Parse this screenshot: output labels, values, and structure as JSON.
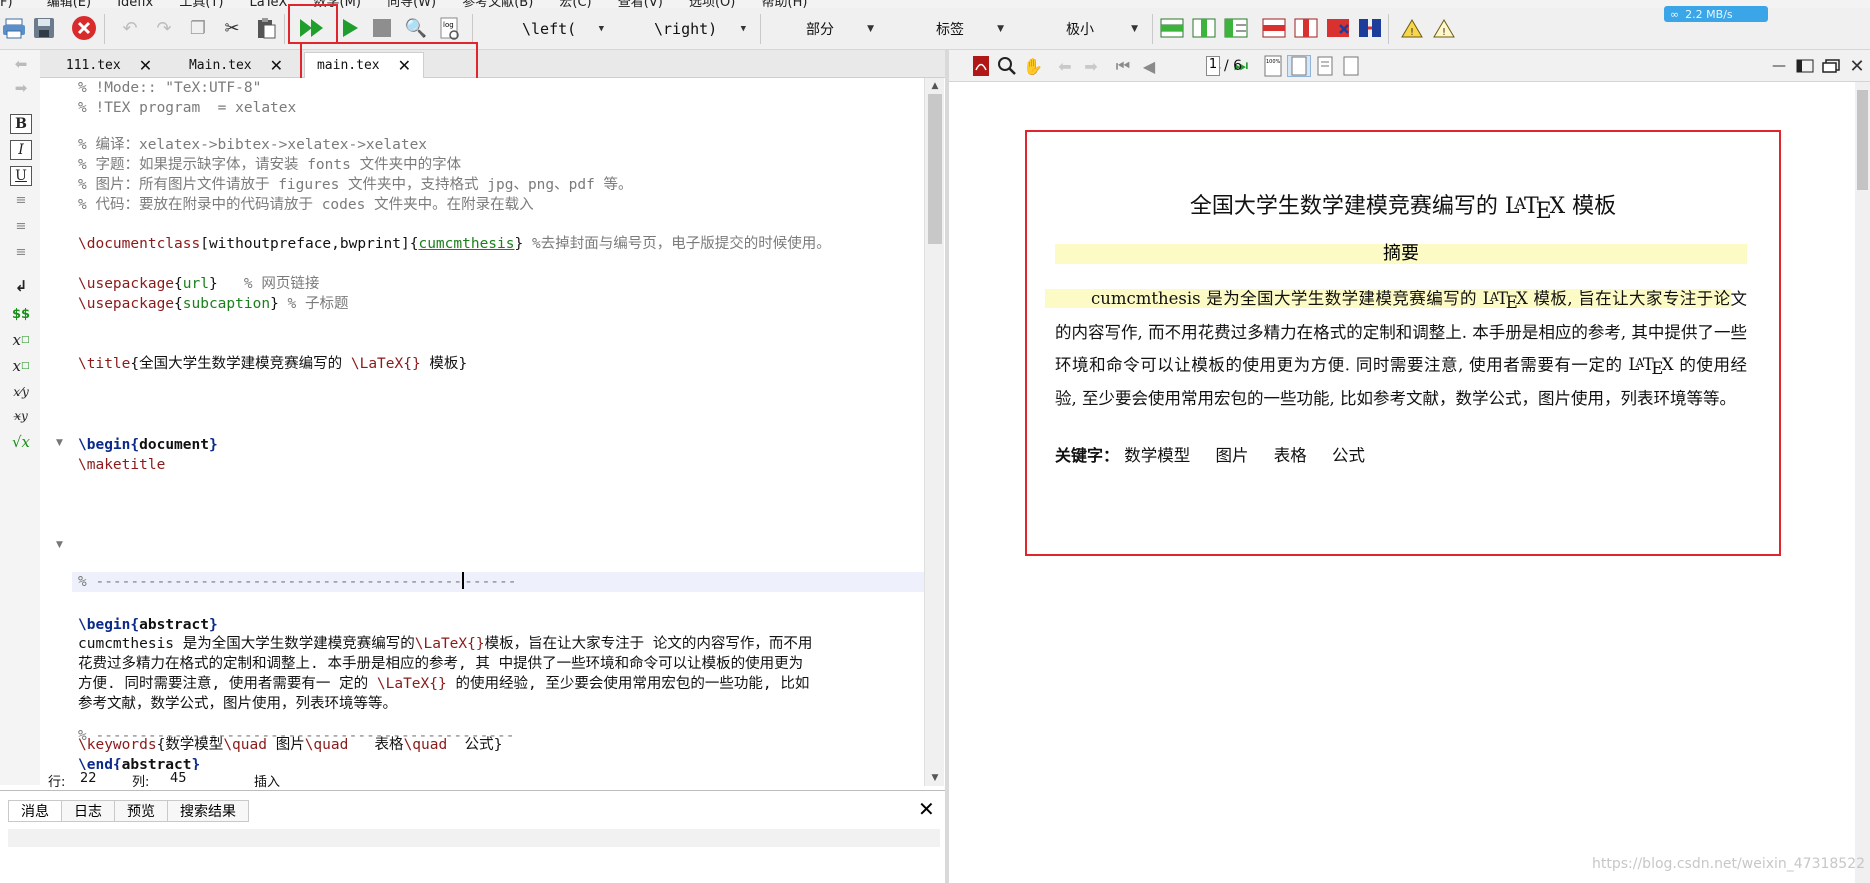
{
  "menubar": {
    "items": [
      "F)",
      "编辑(E)",
      "Idefix",
      "工具(T)",
      "LaTeX",
      "数学(M)",
      "向导(W)",
      "参考文献(B)",
      "宏(C)",
      "查看(V)",
      "选项(O)",
      "帮助(H)"
    ]
  },
  "net_speed": "2.2 MB/s",
  "toolbar": {
    "combo_left": "\\left(",
    "combo_right": "\\right)",
    "combo_section": "部分",
    "combo_label": "标签",
    "combo_size": "极小"
  },
  "tabs": [
    {
      "label": "111.tex"
    },
    {
      "label": "Main.tex"
    },
    {
      "label": "main.tex"
    }
  ],
  "tab_close_glyph": "✕",
  "editor": {
    "l01": "% !Mode:: \"TeX:UTF-8\"",
    "l02": "% !TEX program  = xelatex",
    "l03": "% 编译：xelatex->bibtex->xelatex->xelatex",
    "l04": "% 字题：如果提示缺字体，请安装 fonts 文件夹中的字体",
    "l05": "% 图片：所有图片文件请放于 figures 文件夹中，支持格式 jpg、png、pdf 等。",
    "l06": "% 代码：要放在附录中的代码请放于 codes 文件夹中。在附录在载入",
    "l07_cmd": "\\documentclass",
    "l07_opt": "[withoutpreface,bwprint]",
    "l07_arg": "cumcmthesis",
    "l07_comment": " %去掉封面与编号页，电子版提交的时候使用。",
    "l08_cmd": "\\usepackage",
    "l08_arg": "url",
    "l08_comment": "   % 网页链接",
    "l09_cmd": "\\usepackage",
    "l09_arg": "subcaption",
    "l09_comment": " % 子标题",
    "l10_cmd": "\\title",
    "l10_text": "全国大学生数学建模竞赛编写的 ",
    "l10_cmd2": "\\LaTeX{}",
    "l10_text2": " 模板",
    "l11_cmd": "\\begin",
    "l11_arg": "document",
    "l12": "\\maketitle",
    "l13_a": "% ------------------------------------------",
    "l13_b": "------",
    "l14_cmd": "\\begin",
    "l14_arg": "abstract",
    "l15_a": "cumcmthesis 是为全国大学生数学建模竞赛编写的",
    "l15_cmd": "\\LaTeX{}",
    "l15_b": "模板，旨在让大家专注于 论文的内容写作，而不用",
    "l16": "花费过多精力在格式的定制和调整上. 本手册是相应的参考, 其 中提供了一些环境和命令可以让模板的使用更为",
    "l17_a": "方便. 同时需要注意, 使用者需要有一 定的 ",
    "l17_cmd": "\\LaTeX{}",
    "l17_b": " 的使用经验, 至少要会使用常用宏包的一些功能, 比如",
    "l18": "参考文献，数学公式，图片使用，列表环境等等。",
    "l19_cmd": "\\keywords",
    "l19_t1": "数学模型",
    "l19_q1": "\\quad",
    "l19_t2": " 图片",
    "l19_q2": "\\quad",
    "l19_t3": "   表格",
    "l19_q3": "\\quad",
    "l19_t4": "  公式",
    "l20_cmd": "\\end",
    "l20_arg": "abstract",
    "l21": "% ------------------------------------------------"
  },
  "status": {
    "row_label": "行:",
    "row_value": "22",
    "col_label": "列:",
    "col_value": "45",
    "mode": "插入"
  },
  "log_tabs": [
    "消息",
    "日志",
    "预览",
    "搜索结果"
  ],
  "pdf": {
    "page_current": "1",
    "page_total": "/ 6",
    "title_pre": "全国大学生数学建模竞赛编写的",
    "title_post": "模板",
    "abstract_heading": "摘要",
    "abs_1": "cumcmthesis 是为全国大学生数学建模竞赛编写的",
    "abs_2": "模板, 旨在让大家专注于论",
    "abs_3": "文的内容写作, 而不用花费过多精力在格式的定制和调整上. 本手册是相应的参考, 其中提供了一些环境和命令可以让模板的使用更为方便. 同时需要注意, 使用者需要有一定的",
    "abs_4": "的使用经验, 至少要会使用常用宏包的一些功能, 比如参考文献，数学公式，图片使用，列表环境等等。",
    "keywords_label": "关键字：",
    "keywords": [
      "数学模型",
      "图片",
      "表格",
      "公式"
    ]
  },
  "watermark": "https://blog.csdn.net/weixin_47318522",
  "colors": {
    "highlight_red": "#e0262c",
    "pdf_highlight": "#fdfbc5",
    "tex_command": "#8b1a1a",
    "tex_env": "#0b2a8a",
    "tex_arg": "#1a7f1a",
    "comment": "#7b7b7b"
  }
}
